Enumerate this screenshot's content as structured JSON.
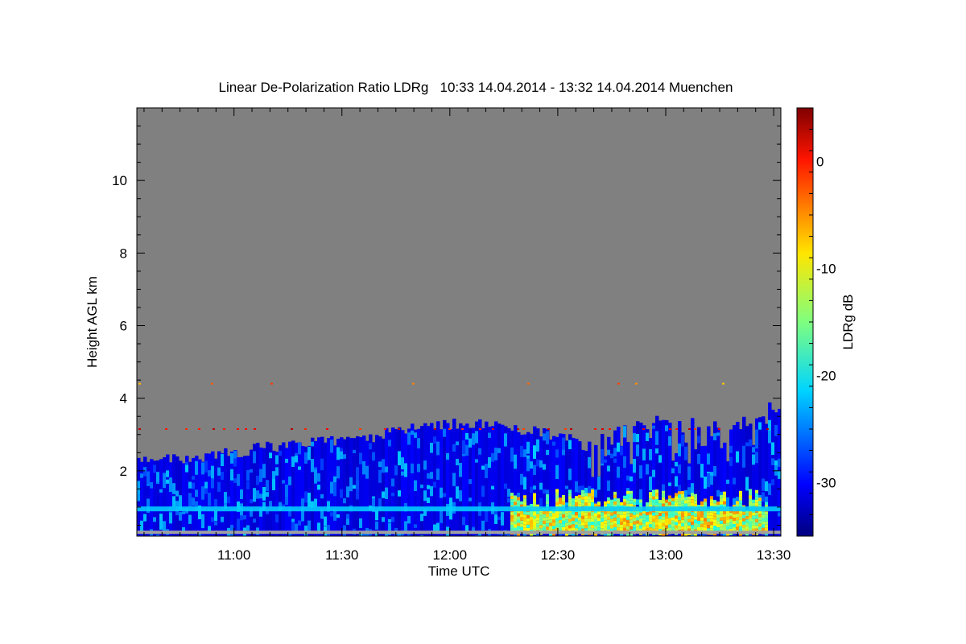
{
  "chart_data": {
    "type": "heatmap",
    "title": "Linear De-Polarization Ratio LDRg   10:33 14.04.2014 - 13:32 14.04.2014 Muenchen",
    "xlabel": "Time UTC",
    "ylabel": "Height AGL km",
    "x_range": [
      "10:33",
      "13:32"
    ],
    "x_ticks": [
      "11:00",
      "11:30",
      "12:00",
      "12:30",
      "13:00",
      "13:30"
    ],
    "ylim": [
      0.2,
      12
    ],
    "y_ticks": [
      2,
      4,
      6,
      8,
      10
    ],
    "no_data_color": "#808080",
    "colorbar": {
      "label": "LDRg dB",
      "range": [
        -35,
        5
      ],
      "ticks": [
        0,
        -10,
        -20,
        -30
      ],
      "colormap": "jet"
    },
    "signal_top_km": [
      {
        "time": "10:33",
        "height": 2.3
      },
      {
        "time": "10:50",
        "height": 2.35
      },
      {
        "time": "11:05",
        "height": 2.6
      },
      {
        "time": "11:20",
        "height": 2.75
      },
      {
        "time": "11:35",
        "height": 2.9
      },
      {
        "time": "11:50",
        "height": 3.15
      },
      {
        "time": "12:00",
        "height": 3.3
      },
      {
        "time": "12:10",
        "height": 3.25
      },
      {
        "time": "12:20",
        "height": 3.1
      },
      {
        "time": "12:30",
        "height": 2.95
      },
      {
        "time": "12:38",
        "height": 2.7
      },
      {
        "time": "12:48",
        "height": 3.2
      },
      {
        "time": "13:00",
        "height": 3.4
      },
      {
        "time": "13:10",
        "height": 3.3
      },
      {
        "time": "13:20",
        "height": 3.3
      },
      {
        "time": "13:32",
        "height": 3.9
      }
    ],
    "high_ldr_region": {
      "time_start": "12:16",
      "time_end": "13:28",
      "height_top_km": 1.5,
      "ldr_db": -12
    },
    "bright_layer": {
      "height_km": 0.95,
      "ldr_db": -22
    },
    "clear_air_layer": {
      "height_km": 3.15,
      "ldr_db": 0
    },
    "clear_air_layer_2": {
      "height_km": 4.4,
      "ldr_db": -5
    }
  }
}
